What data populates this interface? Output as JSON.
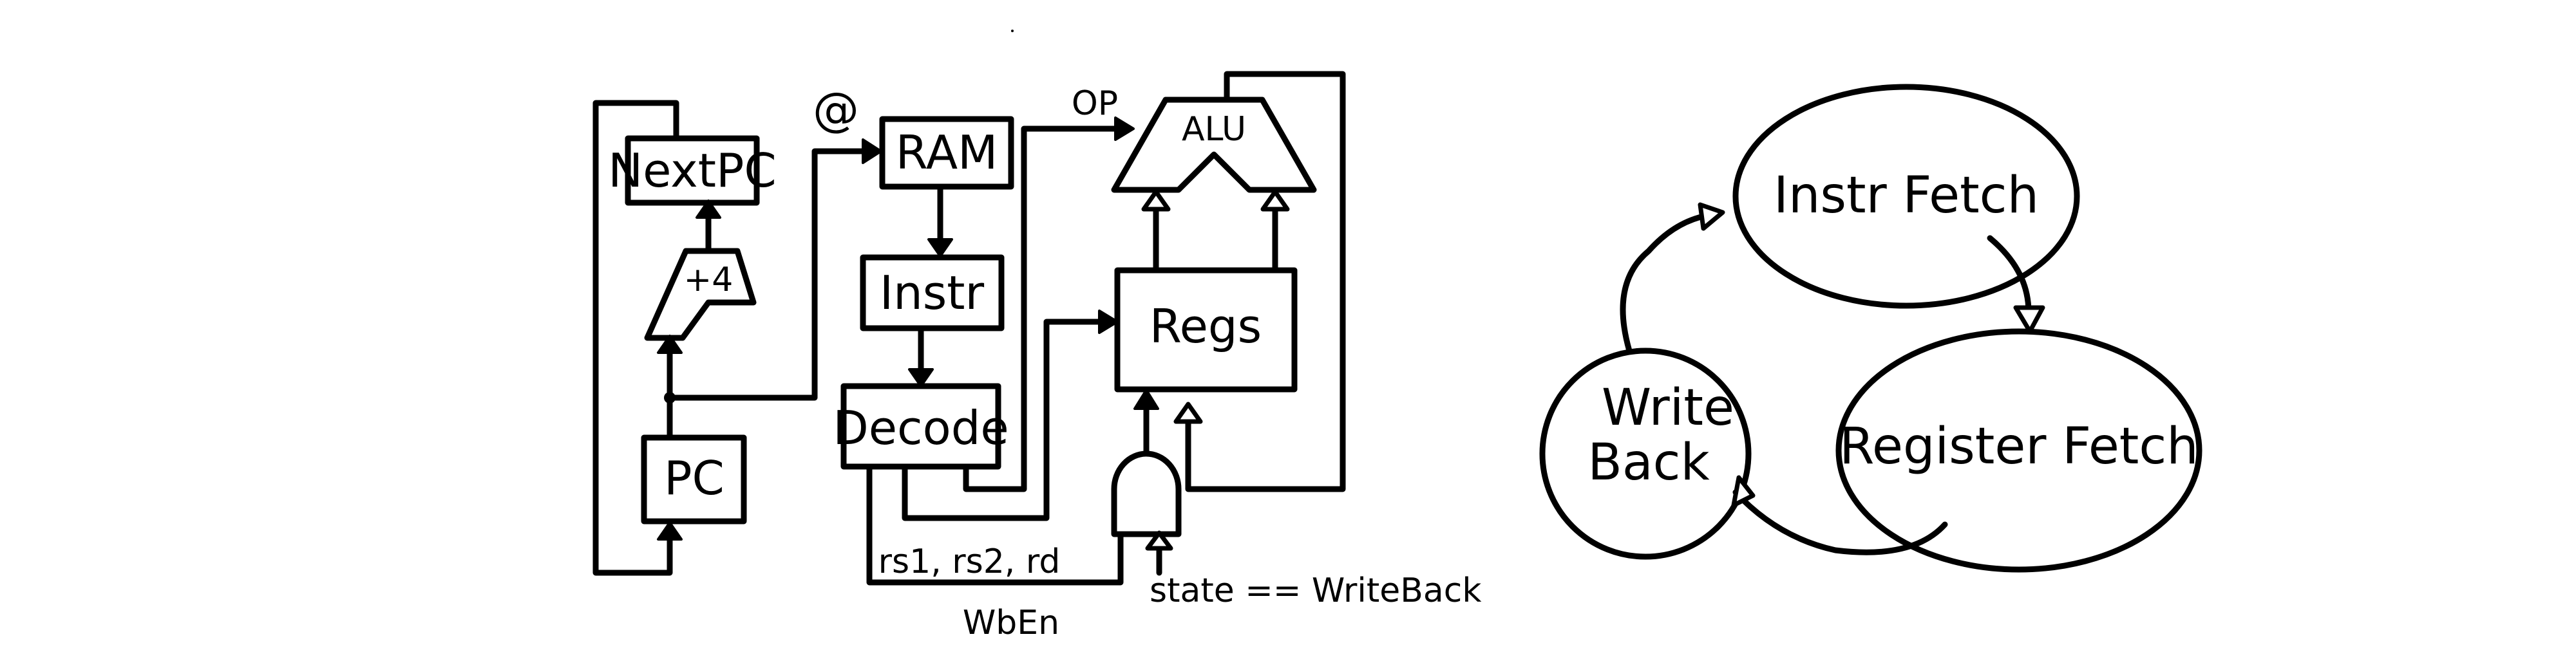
{
  "datapath": {
    "next_pc": "NextPC",
    "plus4": "+4",
    "pc": "PC",
    "addr": "@",
    "ram": "RAM",
    "instr": "Instr",
    "decode": "Decode",
    "op": "OP",
    "alu": "ALU",
    "regs": "Regs",
    "reg_fields": "rs1, rs2, rd",
    "wb_en": "WbEn",
    "state_cond": "state == WriteBack"
  },
  "fsm": {
    "states": [
      {
        "label": "Instr Fetch"
      },
      {
        "label": "Register Fetch"
      },
      {
        "label_line1": "Write",
        "label_line2": "Back"
      }
    ]
  },
  "colors": {
    "ink": "#000000",
    "background": "#ffffff"
  }
}
